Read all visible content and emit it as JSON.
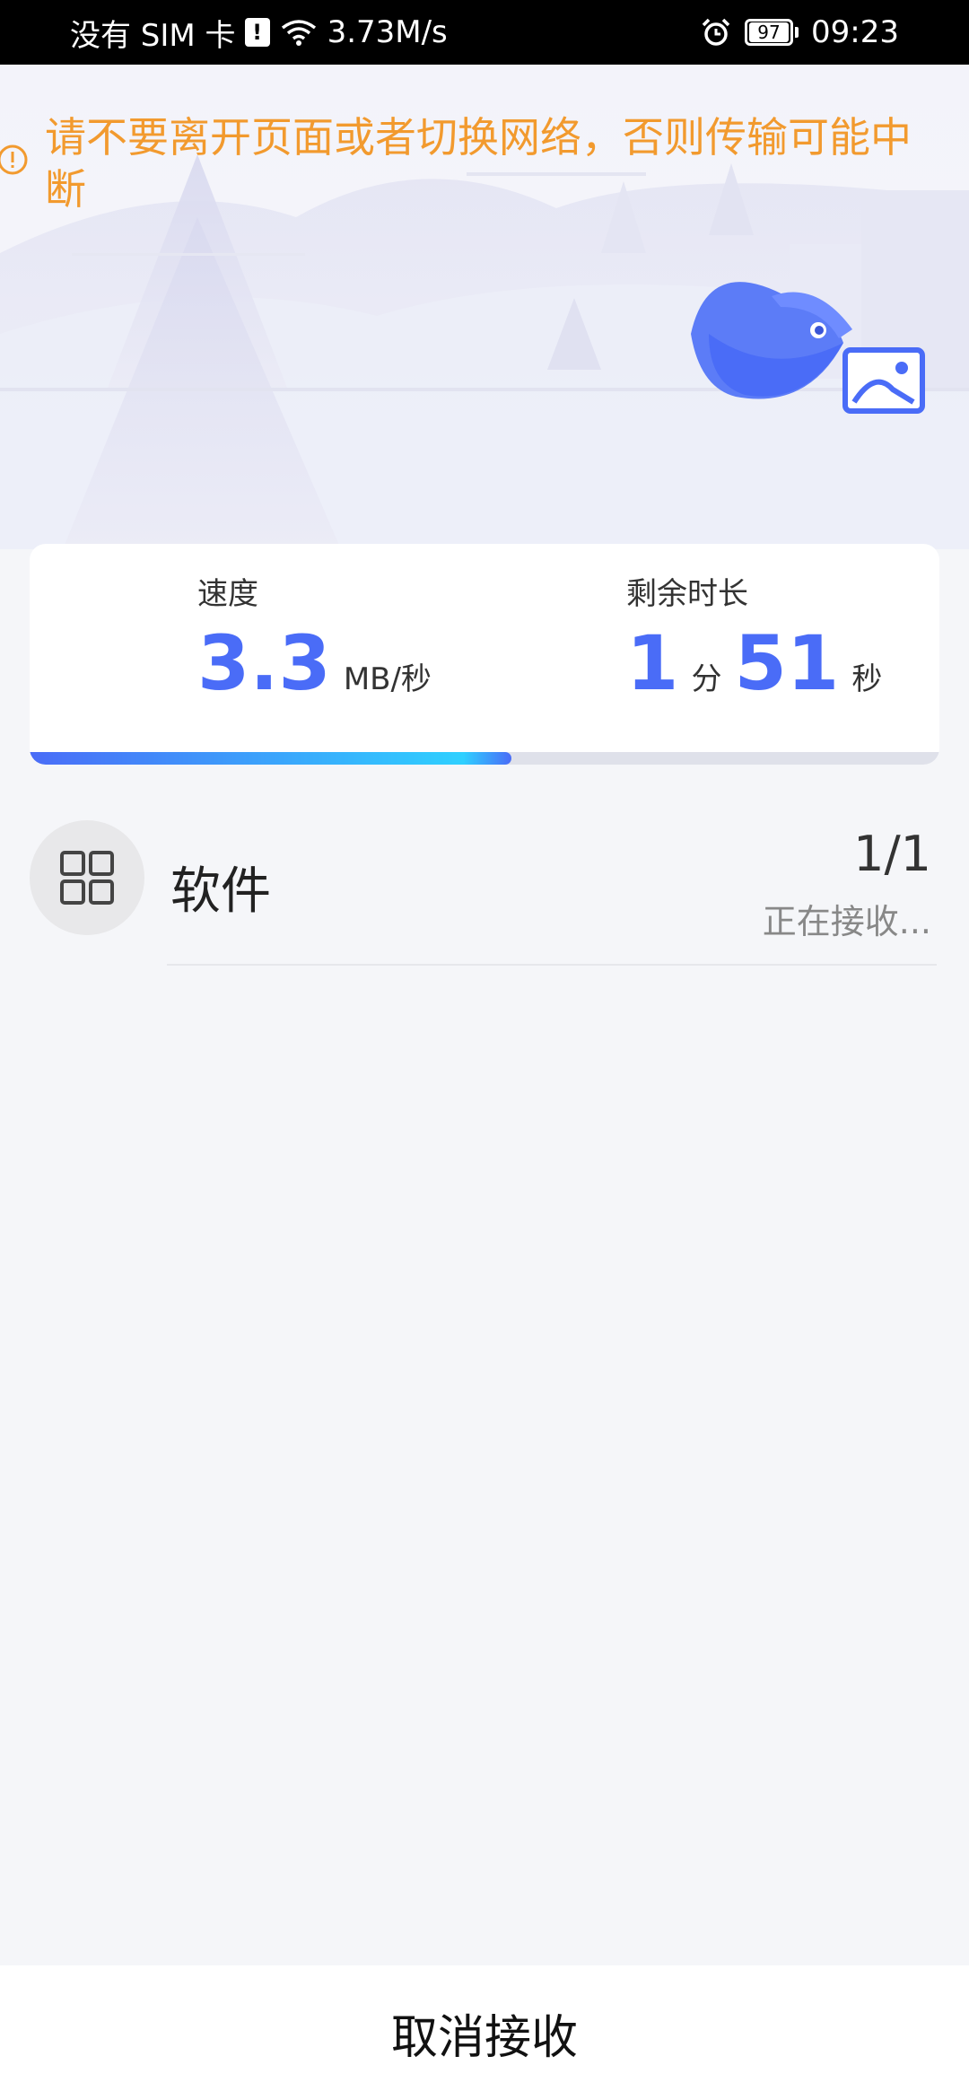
{
  "status_bar": {
    "carrier": "没有 SIM 卡",
    "sim_alert": "!",
    "net_speed": "3.73M/s",
    "battery": "97",
    "time": "09:23"
  },
  "warning": {
    "text": "请不要离开页面或者切换网络，否则传输可能中断"
  },
  "stats": {
    "speed_label": "速度",
    "speed_value": "3.3",
    "speed_unit": "MB/秒",
    "remaining_label": "剩余时长",
    "minutes": "1",
    "minutes_unit": "分",
    "seconds": "51",
    "seconds_unit": "秒",
    "progress_fraction": 0.53
  },
  "file": {
    "name": "软件",
    "count": "1/1",
    "status": "正在接收..."
  },
  "bottom": {
    "cancel_label": "取消接收"
  },
  "colors": {
    "accent": "#4a6cf7",
    "warning": "#f29a2e"
  }
}
